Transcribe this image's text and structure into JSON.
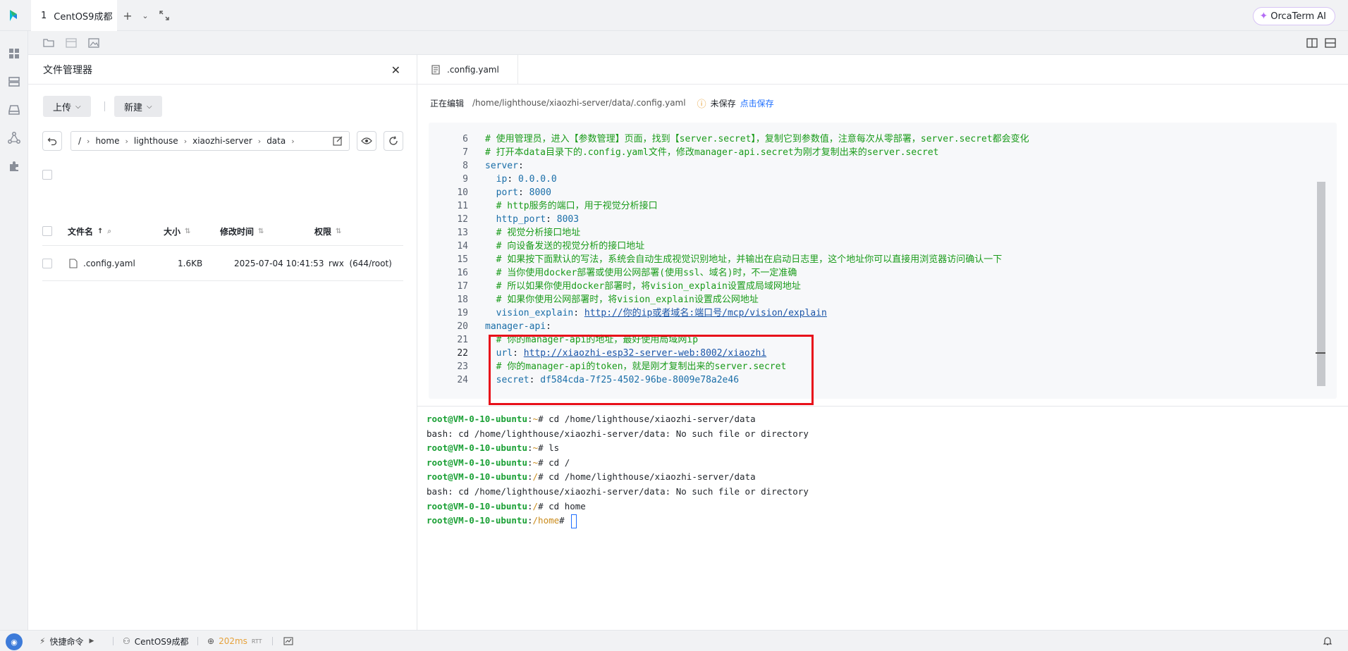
{
  "window": {
    "tab_number": "1",
    "tab_title": "CentOS9成都",
    "ai_button": "OrcaTerm AI"
  },
  "file_manager": {
    "title": "文件管理器",
    "upload_label": "上传",
    "new_label": "新建",
    "path": [
      "/",
      "home",
      "lighthouse",
      "xiaozhi-server",
      "data"
    ],
    "columns": {
      "name": "文件名",
      "size": "大小",
      "modified": "修改时间",
      "permissions": "权限"
    },
    "files": [
      {
        "name": ".config.yaml",
        "size": "1.6KB",
        "modified": "2025-07-04 10:41:53",
        "permissions": "rwx  (644/root)"
      }
    ]
  },
  "editor": {
    "tab_label": ".config.yaml",
    "editing_label": "正在编辑",
    "file_path": "/home/lighthouse/xiaozhi-server/data/.config.yaml",
    "unsaved_label": "未保存",
    "save_link": "点击保存",
    "lines": [
      {
        "n": "6",
        "indent": "",
        "comment": "# 使用管理员，进入【参数管理】页面，找到【server.secret】，复制它到参数值，注意每次从零部署，server.secret都会变化"
      },
      {
        "n": "7",
        "indent": "",
        "comment": "# 打开本data目录下的.config.yaml文件，修改manager-api.secret为刚才复制出来的server.secret"
      },
      {
        "n": "8",
        "indent": "",
        "key": "server",
        "sep": ":"
      },
      {
        "n": "9",
        "indent": "  ",
        "key": "ip",
        "sep": ": ",
        "value": "0.0.0.0"
      },
      {
        "n": "10",
        "indent": "  ",
        "key": "port",
        "sep": ": ",
        "value": "8000"
      },
      {
        "n": "11",
        "indent": "  ",
        "comment": "# http服务的端口，用于视觉分析接口"
      },
      {
        "n": "12",
        "indent": "  ",
        "key": "http_port",
        "sep": ": ",
        "value": "8003"
      },
      {
        "n": "13",
        "indent": "  ",
        "comment": "# 视觉分析接口地址"
      },
      {
        "n": "14",
        "indent": "  ",
        "comment": "# 向设备发送的视觉分析的接口地址"
      },
      {
        "n": "15",
        "indent": "  ",
        "comment": "# 如果按下面默认的写法，系统会自动生成视觉识别地址，并输出在启动日志里，这个地址你可以直接用浏览器访问确认一下"
      },
      {
        "n": "16",
        "indent": "  ",
        "comment": "# 当你使用docker部署或使用公网部署(使用ssl、域名)时，不一定准确"
      },
      {
        "n": "17",
        "indent": "  ",
        "comment": "# 所以如果你使用docker部署时，将vision_explain设置成局域网地址"
      },
      {
        "n": "18",
        "indent": "  ",
        "comment": "# 如果你使用公网部署时，将vision_explain设置成公网地址"
      },
      {
        "n": "19",
        "indent": "  ",
        "key": "vision_explain",
        "sep": ": ",
        "link": "http://你的ip或者域名:端口号/mcp/vision/explain"
      },
      {
        "n": "20",
        "indent": "",
        "key": "manager-api",
        "sep": ":"
      },
      {
        "n": "21",
        "indent": "  ",
        "comment": "# 你的manager-api的地址，最好使用局域网ip"
      },
      {
        "n": "22",
        "indent": "  ",
        "key": "url",
        "sep": ": ",
        "link": "http://xiaozhi-esp32-server-web:8002/xiaozhi",
        "current": true
      },
      {
        "n": "23",
        "indent": "  ",
        "comment": "# 你的manager-api的token，就是刚才复制出来的server.secret"
      },
      {
        "n": "24",
        "indent": "  ",
        "key": "secret",
        "sep": ": ",
        "value": "df584cda-7f25-4502-96be-8009e78a2e46"
      }
    ]
  },
  "terminal": {
    "lines": [
      {
        "user": "root@VM-0-10-ubuntu",
        "path": "~",
        "cmd": "cd /home/lighthouse/xiaozhi-server/data"
      },
      {
        "output": "bash: cd /home/lighthouse/xiaozhi-server/data: No such file or directory"
      },
      {
        "user": "root@VM-0-10-ubuntu",
        "path": "~",
        "cmd": "ls"
      },
      {
        "user": "root@VM-0-10-ubuntu",
        "path": "~",
        "cmd": "cd /"
      },
      {
        "user": "root@VM-0-10-ubuntu",
        "path": "/",
        "cmd": "cd /home/lighthouse/xiaozhi-server/data"
      },
      {
        "output": "bash: cd /home/lighthouse/xiaozhi-server/data: No such file or directory"
      },
      {
        "user": "root@VM-0-10-ubuntu",
        "path": "/",
        "cmd": "cd home"
      },
      {
        "user": "root@VM-0-10-ubuntu",
        "path": "/home",
        "cmd": "",
        "cursor": true
      }
    ]
  },
  "status_bar": {
    "quick_commands": "快捷命令",
    "server_name": "CentOS9成都",
    "latency": "202ms",
    "rtt_label": "RTT"
  },
  "colors": {
    "accent": "#1f6fff",
    "highlight_box": "#e8101a",
    "comment": "#1a9b1a",
    "terminal_user": "#1aa035"
  }
}
